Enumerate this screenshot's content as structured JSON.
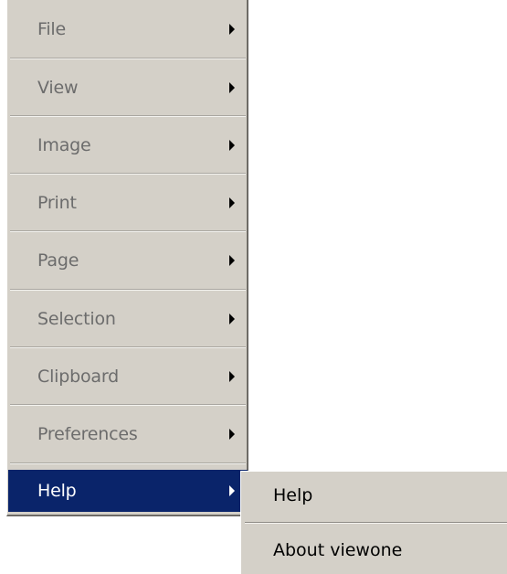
{
  "menu": {
    "items": [
      {
        "label": "File",
        "has_submenu": true,
        "enabled": false
      },
      {
        "label": "View",
        "has_submenu": true,
        "enabled": false
      },
      {
        "label": "Image",
        "has_submenu": true,
        "enabled": false
      },
      {
        "label": "Print",
        "has_submenu": true,
        "enabled": false
      },
      {
        "label": "Page",
        "has_submenu": true,
        "enabled": false
      },
      {
        "label": "Selection",
        "has_submenu": true,
        "enabled": false
      },
      {
        "label": "Clipboard",
        "has_submenu": true,
        "enabled": false
      },
      {
        "label": "Preferences",
        "has_submenu": true,
        "enabled": false
      },
      {
        "label": "Help",
        "has_submenu": true,
        "enabled": true,
        "highlighted": true
      }
    ]
  },
  "submenu": {
    "items": [
      {
        "label": "Help"
      },
      {
        "label": "About viewone"
      }
    ]
  },
  "colors": {
    "menu_bg": "#d4d0c8",
    "highlight_bg": "#0a246a",
    "disabled_text": "#6c6c6c",
    "text": "#000000",
    "highlight_text": "#ffffff"
  },
  "icons": {
    "submenu_indicator": "chevron-right-icon"
  }
}
